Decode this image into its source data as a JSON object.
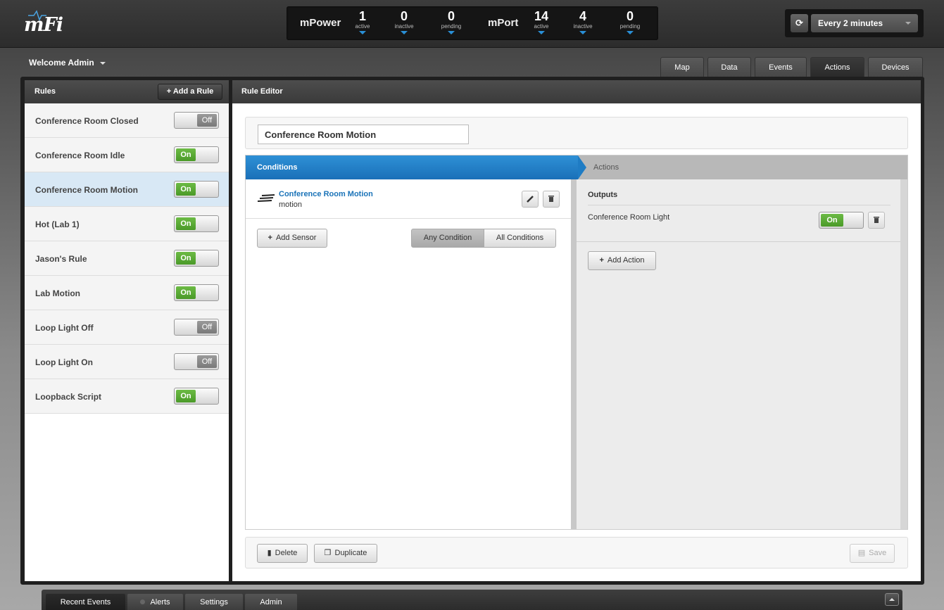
{
  "header": {
    "logo": "mFi",
    "mpower": {
      "label": "mPower",
      "stats": [
        {
          "value": "1",
          "label": "active"
        },
        {
          "value": "0",
          "label": "inactive"
        },
        {
          "value": "0",
          "label": "pending"
        }
      ]
    },
    "mport": {
      "label": "mPort",
      "stats": [
        {
          "value": "14",
          "label": "active"
        },
        {
          "value": "4",
          "label": "inactive"
        },
        {
          "value": "0",
          "label": "pending"
        }
      ]
    },
    "refresh_icon": "refresh-icon",
    "interval": "Every 2 minutes"
  },
  "welcome": "Welcome Admin",
  "nav_tabs": [
    {
      "label": "Map",
      "active": false
    },
    {
      "label": "Data",
      "active": false
    },
    {
      "label": "Events",
      "active": false
    },
    {
      "label": "Actions",
      "active": true
    },
    {
      "label": "Devices",
      "active": false
    }
  ],
  "rules": {
    "title": "Rules",
    "add_label": "Add a Rule",
    "items": [
      {
        "name": "Conference Room Closed",
        "state": "Off"
      },
      {
        "name": "Conference Room Idle",
        "state": "On"
      },
      {
        "name": "Conference Room Motion",
        "state": "On",
        "selected": true
      },
      {
        "name": "Hot (Lab 1)",
        "state": "On"
      },
      {
        "name": "Jason's Rule",
        "state": "On"
      },
      {
        "name": "Lab Motion",
        "state": "On"
      },
      {
        "name": "Loop Light Off",
        "state": "Off"
      },
      {
        "name": "Loop Light On",
        "state": "Off"
      },
      {
        "name": "Loopback Script",
        "state": "On"
      }
    ]
  },
  "editor": {
    "title": "Rule Editor",
    "rule_name": "Conference Room Motion",
    "steps": {
      "conditions": "Conditions",
      "actions": "Actions"
    },
    "condition": {
      "name": "Conference Room Motion",
      "type": "motion",
      "icon": "motion-sensor-icon"
    },
    "add_sensor": "Add Sensor",
    "match_options": [
      "Any Condition",
      "All Conditions"
    ],
    "match_selected": "Any Condition",
    "outputs_label": "Outputs",
    "output": {
      "name": "Conference Room Light",
      "state": "On"
    },
    "add_action": "Add Action",
    "delete": "Delete",
    "duplicate": "Duplicate",
    "save": "Save"
  },
  "footer_tabs": [
    {
      "label": "Recent Events",
      "active": true
    },
    {
      "label": "Alerts",
      "active": false
    },
    {
      "label": "Settings",
      "active": false
    },
    {
      "label": "Admin",
      "active": false
    }
  ],
  "colors": {
    "accent": "#1f7cc4",
    "on": "#55a530",
    "off": "#888888"
  }
}
